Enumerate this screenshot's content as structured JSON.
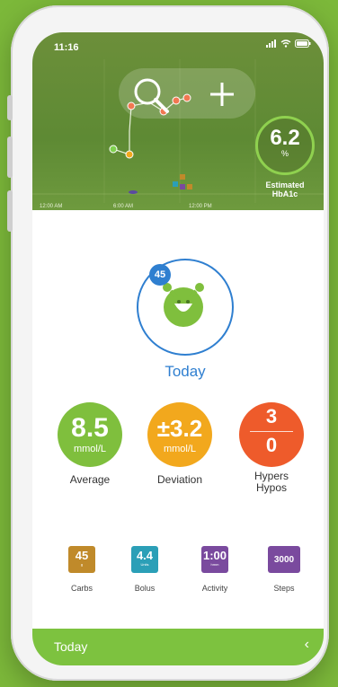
{
  "status_bar": {
    "time": "11:16"
  },
  "hero": {
    "hba1c": {
      "value": "6.2",
      "unit": "%",
      "label_line1": "Estimated",
      "label_line2": "HbA1c"
    },
    "time_labels": [
      "12:00 AM",
      "6:00 AM",
      "12:00 PM"
    ]
  },
  "summary": {
    "badge": "45",
    "period_label": "Today",
    "average": {
      "value": "8.5",
      "unit": "mmol/L",
      "label": "Average",
      "color": "#7fbf3d"
    },
    "deviation": {
      "value": "±3.2",
      "unit": "mmol/L",
      "label": "Deviation",
      "color": "#f2a81d"
    },
    "hypers_hypos": {
      "hypers": "3",
      "hypos": "0",
      "label_line1": "Hypers",
      "label_line2": "Hypos",
      "color": "#ee5b2b"
    }
  },
  "tiles": [
    {
      "value": "45",
      "unit": "g",
      "label": "Carbs",
      "color": "#c08a2a"
    },
    {
      "value": "4.4",
      "unit": "Units",
      "label": "Bolus",
      "color": "#2b9fb7"
    },
    {
      "value": "1:00",
      "unit": "hmm",
      "label": "Activity",
      "color": "#7a4a9e"
    },
    {
      "value": "3000",
      "unit": "",
      "label": "Steps",
      "color": "#7a4a9e"
    }
  ],
  "bottom_bar": {
    "label": "Today",
    "chevron": "‹"
  }
}
